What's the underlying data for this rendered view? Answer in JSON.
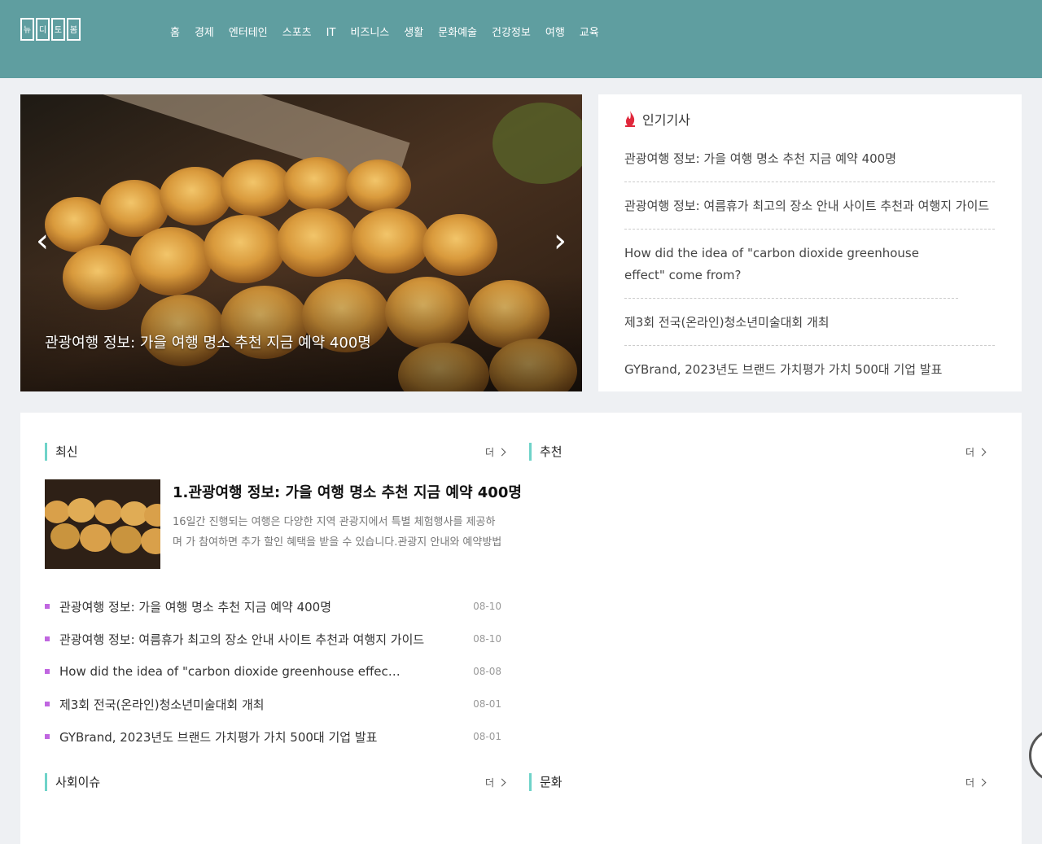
{
  "header": {
    "logo_chars": [
      "뉴",
      "디",
      "토",
      "봄"
    ],
    "nav": [
      "홈",
      "경제",
      "엔터테인",
      "스포츠",
      "IT",
      "비즈니스",
      "생활",
      "문화예술",
      "건강정보",
      "여행",
      "교육"
    ]
  },
  "carousel": {
    "caption": "관광여행 정보: 가을 여행 명소 추천 지금 예약 400명",
    "prev_label": "‹",
    "next_label": "›"
  },
  "hot": {
    "title": "인기기사",
    "items": [
      "관광여행 정보: 가을 여행 명소 추천 지금 예약 400명",
      "관광여행 정보: 여름휴가 최고의 장소 안내 사이트 추천과 여행지 가이드",
      "How did the idea of \"carbon dioxide greenhouse effect\" come from?",
      "제3회 전국(온라인)청소년미술대회 개최",
      "GYBrand, 2023년도 브랜드 가치평가 가치 500대 기업 발표"
    ]
  },
  "sections": {
    "left_top": {
      "title": "최신",
      "more": "더"
    },
    "right_top": {
      "title": "추천",
      "more": "더"
    },
    "left_bottom": {
      "title": "사회이슈",
      "more": "더"
    },
    "right_bottom": {
      "title": "문화",
      "more": "더"
    }
  },
  "feature": {
    "title": "1.관광여행 정보: 가을 여행 명소 추천 지금 예약 400명",
    "desc": "16일간 진행되는 여행은 다양한 지역 관광지에서 특별 체험행사를 제공하며 가 참여하면 추가 할인 혜택을 받을 수 있습니다.관광지 안내와 예약방법은 홈페이지"
  },
  "news": [
    {
      "title": "관광여행 정보: 가을 여행 명소 추천 지금 예약 400명",
      "date": "08-10"
    },
    {
      "title": "관광여행 정보: 여름휴가 최고의 장소 안내 사이트 추천과 여행지 가이드",
      "date": "08-10"
    },
    {
      "title": "How did the idea of \"carbon dioxide greenhouse effec…",
      "date": "08-08"
    },
    {
      "title": "제3회 전국(온라인)청소년미술대회 개최",
      "date": "08-01"
    },
    {
      "title": "GYBrand, 2023년도 브랜드 가치평가 가치 500대 기업 발표",
      "date": "08-01"
    }
  ],
  "colors": {
    "header_bg": "#5f9ea0",
    "section_accent": "#6fd3c9",
    "bullet": "#c066e0"
  }
}
